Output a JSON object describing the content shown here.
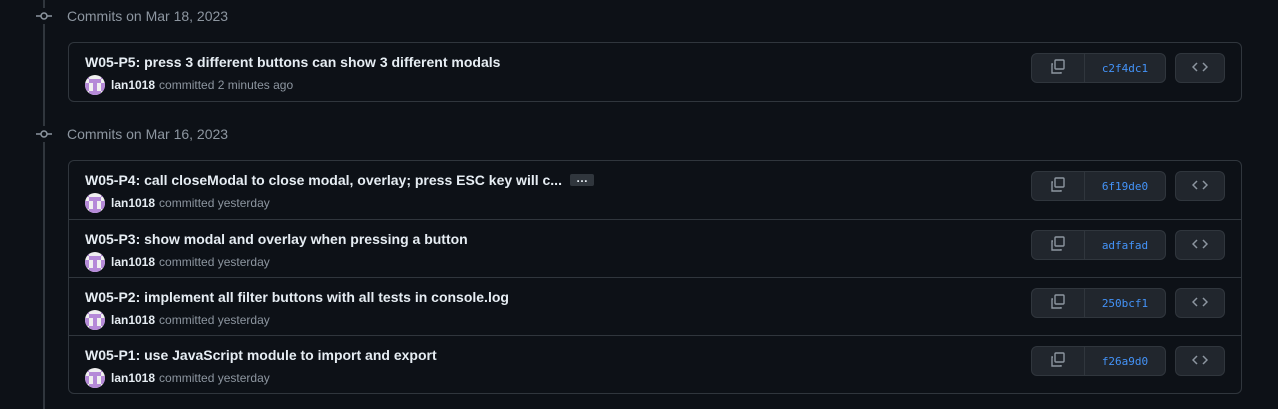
{
  "groups": [
    {
      "title": "Commits on Mar 18, 2023",
      "commits": [
        {
          "message": "W05-P5: press 3 different buttons can show 3 different modals",
          "author": "lan1018",
          "action": "committed",
          "time": "2 minutes ago",
          "sha": "c2f4dc1",
          "truncated": false
        }
      ]
    },
    {
      "title": "Commits on Mar 16, 2023",
      "commits": [
        {
          "message": "W05-P4: call closeModal to close modal, overlay; press ESC key will c...",
          "author": "lan1018",
          "action": "committed",
          "time": "yesterday",
          "sha": "6f19de0",
          "truncated": true,
          "ellipsis_label": "…"
        },
        {
          "message": "W05-P3: show modal and overlay when pressing a button",
          "author": "lan1018",
          "action": "committed",
          "time": "yesterday",
          "sha": "adfafad",
          "truncated": false
        },
        {
          "message": "W05-P2: implement all filter buttons with all tests in console.log",
          "author": "lan1018",
          "action": "committed",
          "time": "yesterday",
          "sha": "250bcf1",
          "truncated": false
        },
        {
          "message": "W05-P1: use JavaScript module to import and export",
          "author": "lan1018",
          "action": "committed",
          "time": "yesterday",
          "sha": "f26a9d0",
          "truncated": false
        }
      ]
    }
  ],
  "icons": {
    "group": "git-commit-icon",
    "copy": "copy-icon",
    "browse": "code-icon"
  },
  "colors": {
    "background": "#0d1117",
    "border": "#30363d",
    "sha_link": "#4493f8",
    "avatar_primary": "#b58ad8",
    "avatar_secondary": "#f0f0f0"
  }
}
